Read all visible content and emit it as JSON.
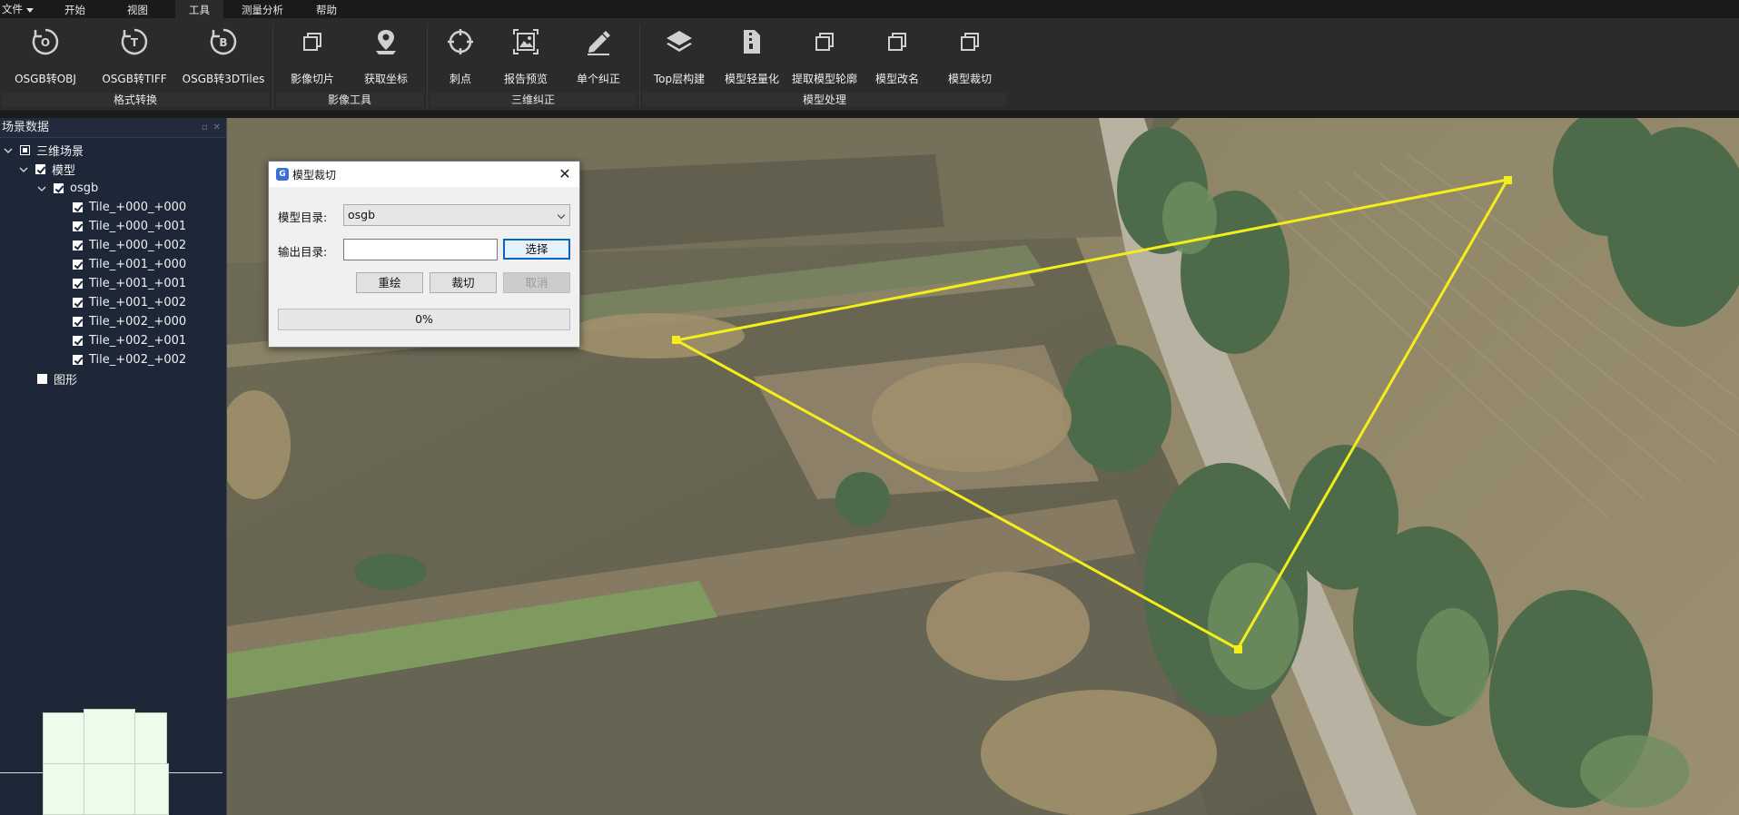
{
  "menubar": {
    "file": "文件",
    "tabs": [
      "开始",
      "视图",
      "工具",
      "测量分析",
      "帮助"
    ],
    "active_tab": "工具"
  },
  "ribbon": {
    "groups": [
      {
        "label": "格式转换"
      },
      {
        "label": "影像工具"
      },
      {
        "label": "三维纠正"
      },
      {
        "label": "模型处理"
      }
    ],
    "tools": [
      {
        "label": "OSGB转OBJ",
        "icon": "osgb-to-obj-icon"
      },
      {
        "label": "OSGB转TIFF",
        "icon": "osgb-to-tiff-icon"
      },
      {
        "label": "OSGB转3DTiles",
        "icon": "osgb-to-3dtiles-icon"
      },
      {
        "label": "影像切片",
        "icon": "copy-stack-icon"
      },
      {
        "label": "获取坐标",
        "icon": "map-pin-icon"
      },
      {
        "label": "刺点",
        "icon": "crosshair-icon"
      },
      {
        "label": "报告预览",
        "icon": "image-report-icon"
      },
      {
        "label": "单个纠正",
        "icon": "pencil-icon"
      },
      {
        "label": "Top层构建",
        "icon": "layers-icon"
      },
      {
        "label": "模型轻量化",
        "icon": "zip-file-icon"
      },
      {
        "label": "提取模型轮廓",
        "icon": "copy-stack-icon"
      },
      {
        "label": "模型改名",
        "icon": "copy-stack-icon"
      },
      {
        "label": "模型裁切",
        "icon": "copy-stack-icon"
      }
    ]
  },
  "panel": {
    "title": "场景数据",
    "tree": [
      {
        "label": "三维场景",
        "state": "partial",
        "expand": true
      },
      {
        "label": "模型",
        "state": "checked",
        "expand": true
      },
      {
        "label": "osgb",
        "state": "checked",
        "expand": true
      },
      {
        "label": "Tile_+000_+000",
        "state": "checked"
      },
      {
        "label": "Tile_+000_+001",
        "state": "checked"
      },
      {
        "label": "Tile_+000_+002",
        "state": "checked"
      },
      {
        "label": "Tile_+001_+000",
        "state": "checked"
      },
      {
        "label": "Tile_+001_+001",
        "state": "checked"
      },
      {
        "label": "Tile_+001_+002",
        "state": "checked"
      },
      {
        "label": "Tile_+002_+000",
        "state": "checked"
      },
      {
        "label": "Tile_+002_+001",
        "state": "checked"
      },
      {
        "label": "Tile_+002_+002",
        "state": "checked"
      },
      {
        "label": "图形",
        "state": "empty"
      }
    ]
  },
  "dialog": {
    "title": "模型裁切",
    "model_dir_label": "模型目录:",
    "model_dir_value": "osgb",
    "output_dir_label": "输出目录:",
    "output_dir_value": "",
    "select_button": "选择",
    "redraw_button": "重绘",
    "clip_button": "裁切",
    "cancel_button": "取消",
    "progress": "0%",
    "close": "✕"
  },
  "colors": {
    "clip_polygon": "#f4ee1a",
    "accent": "#0a64c8"
  }
}
